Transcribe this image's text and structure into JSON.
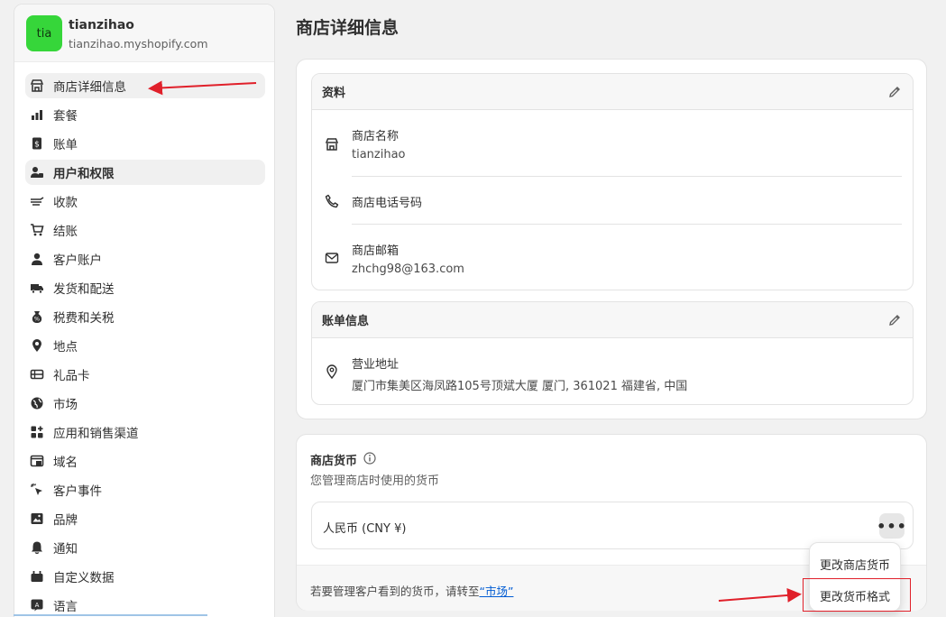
{
  "store": {
    "avatar_text": "tia",
    "name": "tianzihao",
    "domain": "tianzihao.myshopify.com"
  },
  "sidebar": {
    "items": [
      {
        "label": "商店详细信息",
        "icon": "store-icon"
      },
      {
        "label": "套餐",
        "icon": "plan-icon"
      },
      {
        "label": "账单",
        "icon": "billing-icon"
      },
      {
        "label": "用户和权限",
        "icon": "users-icon"
      },
      {
        "label": "收款",
        "icon": "payments-icon"
      },
      {
        "label": "结账",
        "icon": "cart-icon"
      },
      {
        "label": "客户账户",
        "icon": "person-icon"
      },
      {
        "label": "发货和配送",
        "icon": "truck-icon"
      },
      {
        "label": "税费和关税",
        "icon": "tax-icon"
      },
      {
        "label": "地点",
        "icon": "location-icon"
      },
      {
        "label": "礼品卡",
        "icon": "gift-card-icon"
      },
      {
        "label": "市场",
        "icon": "globe-icon"
      },
      {
        "label": "应用和销售渠道",
        "icon": "apps-icon"
      },
      {
        "label": "域名",
        "icon": "domain-icon"
      },
      {
        "label": "客户事件",
        "icon": "cursor-icon"
      },
      {
        "label": "品牌",
        "icon": "brand-icon"
      },
      {
        "label": "通知",
        "icon": "bell-icon"
      },
      {
        "label": "自定义数据",
        "icon": "data-icon"
      },
      {
        "label": "语言",
        "icon": "language-icon"
      }
    ]
  },
  "page": {
    "title": "商店详细信息"
  },
  "profile": {
    "header": "资料",
    "store_name_label": "商店名称",
    "store_name_value": "tianzihao",
    "phone_label": "商店电话号码",
    "email_label": "商店邮箱",
    "email_value": "zhchg98@163.com"
  },
  "billing": {
    "header": "账单信息",
    "address_label": "营业地址",
    "address_value": "厦门市集美区海凤路105号顶斌大厦 厦门, 361021 福建省, 中国"
  },
  "currency": {
    "title": "商店货币",
    "description": "您管理商店时使用的货币",
    "value": "人民币 (CNY ¥)",
    "more_label": "•••",
    "footer_text": "若要管理客户看到的货币，请转至",
    "footer_link": "“市场”"
  },
  "dropdown": {
    "items": [
      "更改商店货币",
      "更改货币格式"
    ]
  },
  "colors": {
    "avatar": "#36d63a",
    "annotation": "#e0202a",
    "link": "#005bd3"
  }
}
